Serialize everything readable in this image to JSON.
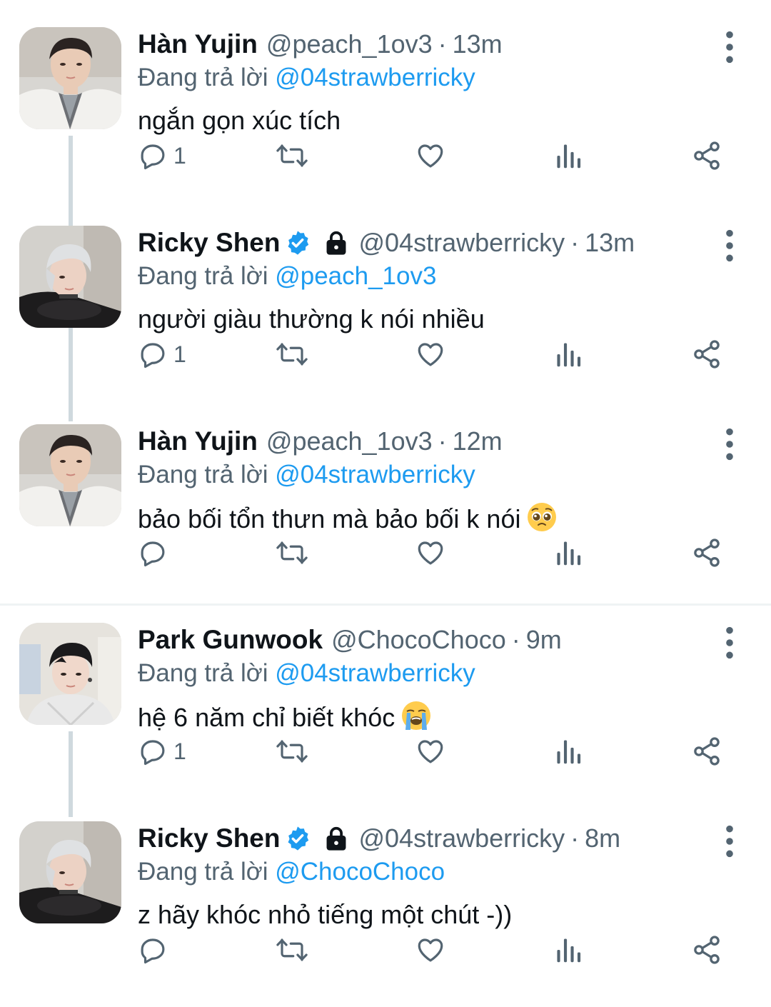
{
  "colors": {
    "link": "#1d9bf0",
    "muted": "#536471",
    "text": "#0f1419",
    "verified": "#1d9bf0"
  },
  "reply_prefix": "Đang trả lời",
  "tweets": [
    {
      "name": "Hàn Yujin",
      "handle": "@peach_1ov3",
      "time": "13m",
      "reply_to": "@04strawberricky",
      "text": "ngắn gọn xúc tích",
      "verified": false,
      "locked": false,
      "reply_count": "1",
      "emoji": ""
    },
    {
      "name": "Ricky Shen",
      "handle": "@04strawberricky",
      "time": "13m",
      "reply_to": "@peach_1ov3",
      "text": "người giàu thường k nói nhiều",
      "verified": true,
      "locked": true,
      "reply_count": "1",
      "emoji": ""
    },
    {
      "name": "Hàn Yujin",
      "handle": "@peach_1ov3",
      "time": "12m",
      "reply_to": "@04strawberricky",
      "text": "bảo bối tổn thưn mà bảo bối k nói",
      "verified": false,
      "locked": false,
      "reply_count": "",
      "emoji": "pleading-face-emoji"
    },
    {
      "name": "Park Gunwook",
      "handle": "@ChocoChoco",
      "time": "9m",
      "reply_to": "@04strawberricky",
      "text": "hệ 6 năm chỉ biết khóc",
      "verified": false,
      "locked": false,
      "reply_count": "1",
      "emoji": "loudly-crying-face-emoji"
    },
    {
      "name": "Ricky Shen",
      "handle": "@04strawberricky",
      "time": "8m",
      "reply_to": "@ChocoChoco",
      "text": "z hãy khóc nhỏ tiếng một chút -))",
      "verified": true,
      "locked": true,
      "reply_count": "",
      "emoji": ""
    }
  ],
  "icons": {
    "reply": "reply-icon",
    "retweet": "retweet-icon",
    "like": "like-icon",
    "views": "views-icon",
    "share": "share-icon",
    "more": "more-icon"
  }
}
